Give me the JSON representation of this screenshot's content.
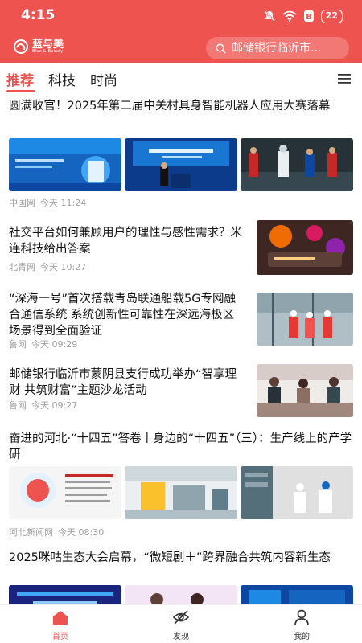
{
  "status_bar": {
    "time": "4:15",
    "battery": "22"
  },
  "header": {
    "logo_cn": "蓝与美",
    "logo_en": "Blue & Beauty",
    "search_placeholder": "邮储银行临沂市..."
  },
  "tabs": [
    {
      "label": "推荐",
      "active": true
    },
    {
      "label": "科技",
      "active": false
    },
    {
      "label": "时尚",
      "active": false
    }
  ],
  "articles": [
    {
      "title": "圆满收官！2025年第二届中关村具身智能机器人应用大赛落幕",
      "source": "中国网",
      "time": "今天 11:24"
    },
    {
      "title": "社交平台如何兼顾用户的理性与感性需求？米连科技给出答案",
      "source": "北青网",
      "time": "今天 10:27"
    },
    {
      "title": "“深海一号”首次搭载青岛联通船载5G专网融合通信系统 系统创新性可靠性在深远海极区场景得到全面验证",
      "source": "鲁网",
      "time": "今天 09:29"
    },
    {
      "title": "邮储银行临沂市蒙阴县支行成功举办“智享理财 共筑财富”主题沙龙活动",
      "source": "鲁网",
      "time": "今天 09:27"
    },
    {
      "title": "奋进的河北·“十四五”答卷丨身边的“十四五”（三）：生产线上的产学研",
      "source": "河北新闻网",
      "time": "今天 08:30"
    },
    {
      "title": "2025咪咕生态大会启幕，“微短剧＋”跨界融合共筑内容新生态",
      "source": "",
      "time": ""
    }
  ],
  "bottom_nav": [
    {
      "label": "首页",
      "active": true
    },
    {
      "label": "发现",
      "active": false
    },
    {
      "label": "我的",
      "active": false
    }
  ],
  "colors": {
    "brand": "#ef5350",
    "meta_text": "#9e9e9e"
  }
}
